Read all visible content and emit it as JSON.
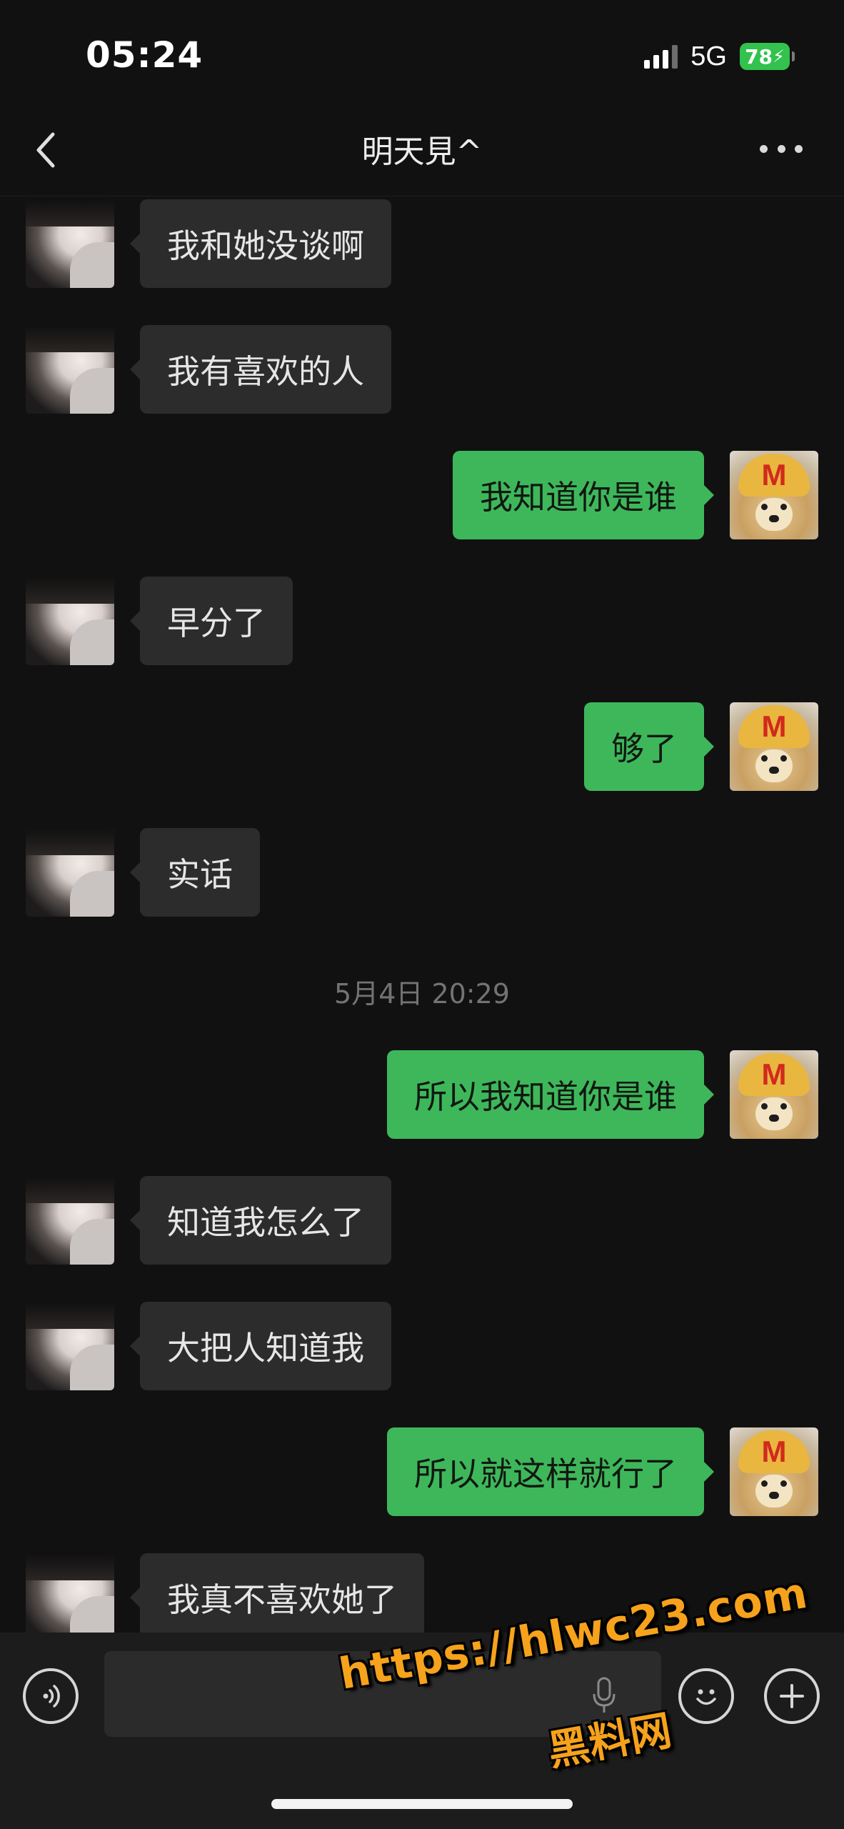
{
  "status_bar": {
    "time": "05:24",
    "network": "5G",
    "battery": "78"
  },
  "header": {
    "title": "明天見^",
    "back_icon": "chevron-left-icon",
    "more_icon": "more-dots-icon"
  },
  "messages": [
    {
      "side": "left",
      "text": "我和她没谈啊"
    },
    {
      "side": "left",
      "text": "我有喜欢的人"
    },
    {
      "side": "right",
      "text": "我知道你是谁"
    },
    {
      "side": "left",
      "text": "早分了"
    },
    {
      "side": "right",
      "text": "够了"
    },
    {
      "side": "left",
      "text": "实话"
    },
    {
      "type": "timestamp",
      "text": "5月4日 20:29"
    },
    {
      "side": "right",
      "text": "所以我知道你是谁"
    },
    {
      "side": "left",
      "text": "知道我怎么了"
    },
    {
      "side": "left",
      "text": "大把人知道我"
    },
    {
      "side": "right",
      "text": "所以就这样就行了"
    },
    {
      "side": "left",
      "text": "我真不喜欢她了"
    }
  ],
  "input_bar": {
    "voice_icon": "voice-icon",
    "emoji_icon": "emoji-icon",
    "plus_icon": "plus-icon",
    "text_value": ""
  },
  "watermark": {
    "url": "https://hlwc23.com",
    "site_name": "黑料网"
  },
  "colors": {
    "background": "#111111",
    "incoming_bubble": "#2c2c2c",
    "outgoing_bubble": "#3eb75b",
    "watermark": "#f6a21c",
    "battery": "#32c24d"
  }
}
